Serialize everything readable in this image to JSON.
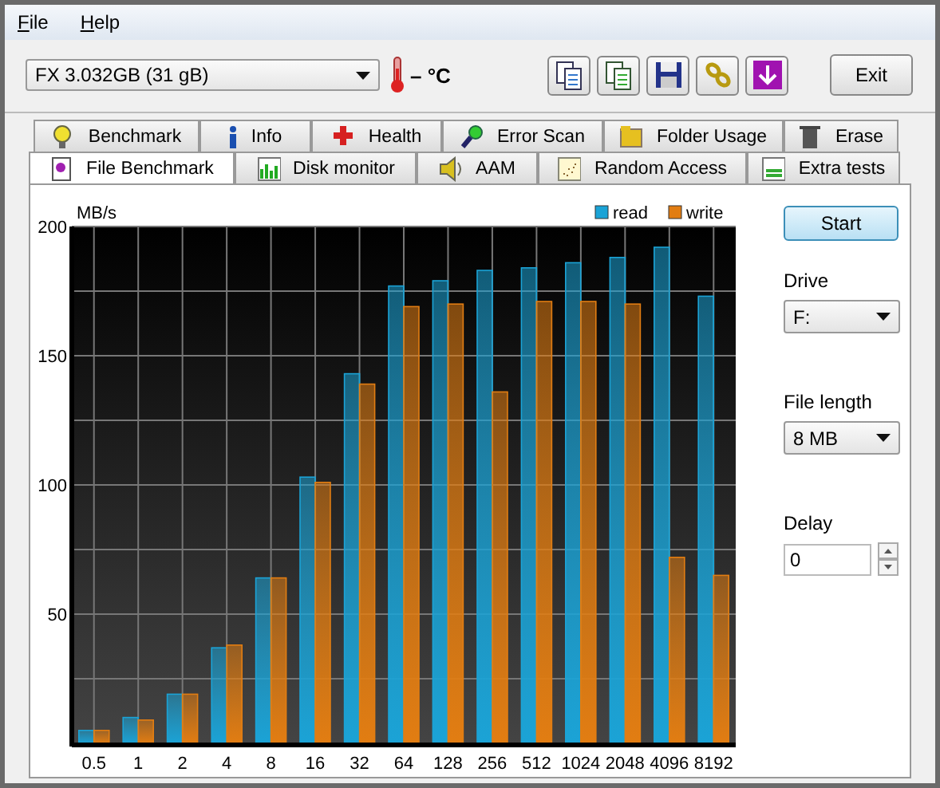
{
  "menu": [
    {
      "label": "File"
    },
    {
      "label": "Help"
    }
  ],
  "toolbar": {
    "drive": "FX 3.032GB (31 gB)",
    "temperature": "– °C",
    "exit": "Exit"
  },
  "tab_rows": [
    [
      {
        "label": "Benchmark",
        "selected": false
      },
      {
        "label": "Info",
        "selected": false
      },
      {
        "label": "Health",
        "selected": false
      },
      {
        "label": "Error Scan",
        "selected": false
      },
      {
        "label": "Folder Usage",
        "selected": false
      },
      {
        "label": "Erase",
        "selected": false
      }
    ],
    [
      {
        "label": "File Benchmark",
        "selected": true
      },
      {
        "label": "Disk monitor",
        "selected": false
      },
      {
        "label": "AAM",
        "selected": false
      },
      {
        "label": "Random Access",
        "selected": false
      },
      {
        "label": "Extra tests",
        "selected": false
      }
    ]
  ],
  "chart_data": {
    "type": "bar",
    "ylabel": "MB/s",
    "categories": [
      "0.5",
      "1",
      "2",
      "4",
      "8",
      "16",
      "32",
      "64",
      "128",
      "256",
      "512",
      "1024",
      "2048",
      "4096",
      "8192"
    ],
    "series": [
      {
        "name": "read",
        "color": "#1ba3d6",
        "values": [
          5,
          10,
          19,
          37,
          64,
          103,
          143,
          177,
          179,
          183,
          184,
          186,
          188,
          192,
          173
        ]
      },
      {
        "name": "write",
        "color": "#e27d12",
        "values": [
          5,
          9,
          19,
          38,
          64,
          101,
          139,
          169,
          170,
          136,
          171,
          171,
          170,
          72,
          65
        ]
      }
    ],
    "ylim": [
      0,
      200
    ],
    "yticks": [
      50,
      100,
      150,
      200
    ],
    "grid": true,
    "legend": true
  },
  "panel": {
    "start": "Start",
    "drive_label": "Drive",
    "drive": "F:",
    "file_length_label": "File length",
    "file_length": "8 MB",
    "delay_label": "Delay",
    "delay": "0"
  }
}
